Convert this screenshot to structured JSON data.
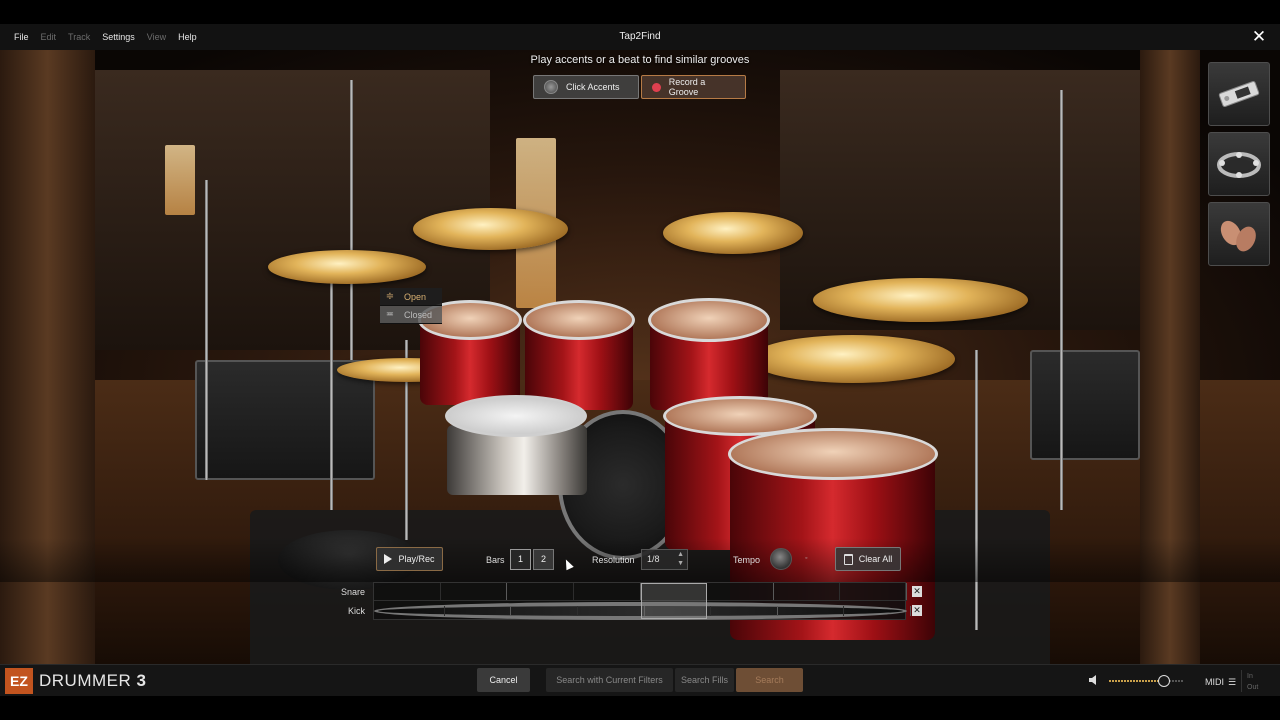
{
  "window": {
    "title": "Tap2Find"
  },
  "menu": {
    "items": [
      {
        "label": "File",
        "enabled": true
      },
      {
        "label": "Edit",
        "enabled": false
      },
      {
        "label": "Track",
        "enabled": false
      },
      {
        "label": "Settings",
        "enabled": true
      },
      {
        "label": "View",
        "enabled": false
      },
      {
        "label": "Help",
        "enabled": true
      }
    ]
  },
  "tap2find": {
    "instruction": "Play accents or a beat to find similar grooves",
    "click_accents_label": "Click Accents",
    "record_groove_label": "Record a Groove"
  },
  "hihat_popup": {
    "open_label": "Open",
    "closed_label": "Closed"
  },
  "instruments": [
    {
      "icon": "tambourine-block-icon"
    },
    {
      "icon": "tambourine-icon"
    },
    {
      "icon": "hand-clap-icon"
    }
  ],
  "groove_editor": {
    "play_label": "Play/Rec",
    "bars_label": "Bars",
    "bars_options": [
      "1",
      "2"
    ],
    "bars_selected": "1",
    "resolution_label": "Resolution",
    "resolution_value": "1/8",
    "tempo_label": "Tempo",
    "clear_all_label": "Clear All",
    "rows": [
      {
        "label": "Snare"
      },
      {
        "label": "Kick"
      }
    ],
    "steps": 8
  },
  "footer": {
    "logo_ez": "EZ",
    "logo_name": "DRUMMER",
    "logo_version_number": "3",
    "cancel_label": "Cancel",
    "search_current_label": "Search with Current Filters",
    "search_fills_label": "Search Fills",
    "search_label": "Search",
    "midi_label": "MIDI",
    "in_label": "In",
    "out_label": "Out"
  },
  "colors": {
    "accent": "#c2541f",
    "record": "#e0404f",
    "gold": "#d8b072"
  }
}
